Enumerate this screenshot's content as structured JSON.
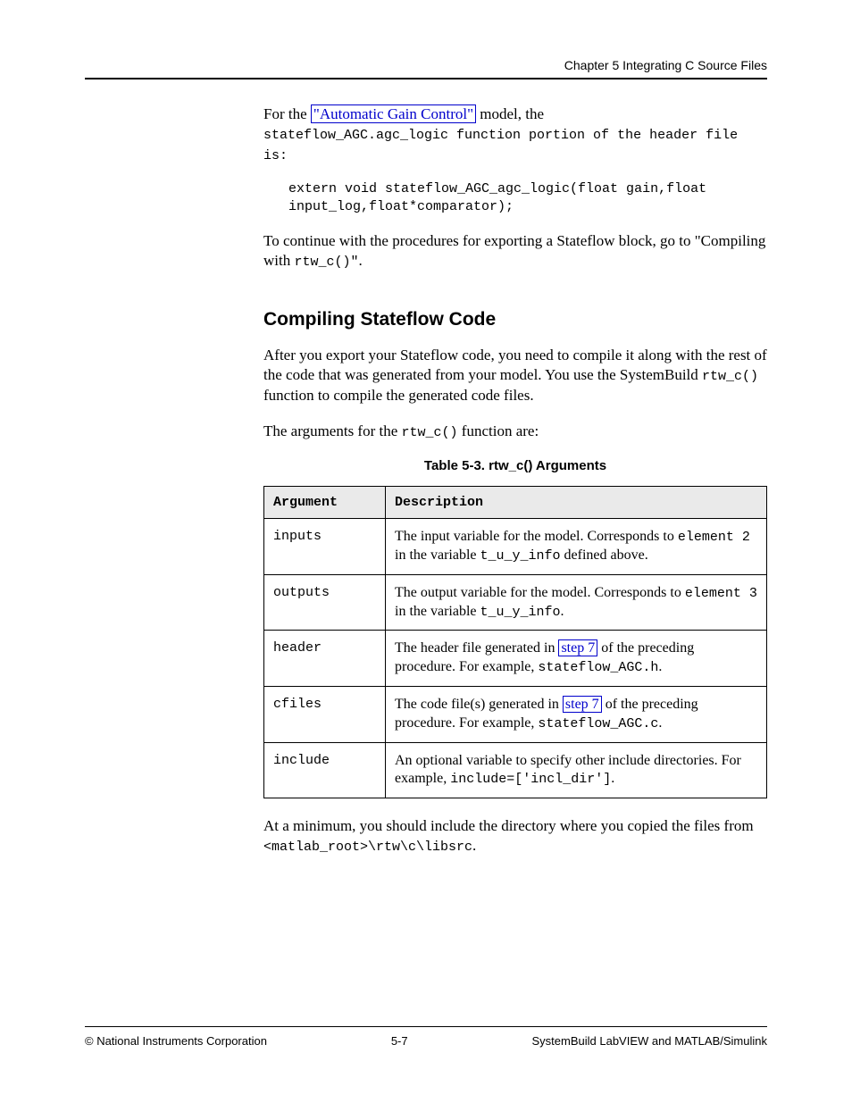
{
  "header": {
    "title": "Chapter 5 Integrating C Source Files"
  },
  "content": {
    "p1_prefix": "For the ",
    "p1_link": "\"Automatic Gain Control\"",
    "p1_suffix": " model, the",
    "p2": "stateflow_AGC.agc_logic function portion of the header file is:",
    "code1_1": "extern void stateflow_AGC_agc_logic(float gain,float",
    "code1_2": "input_log,float*comparator);",
    "p3_prefix": "To continue with the procedures for exporting a Stateflow block, go to",
    "p3_link_pre": "\"Compiling with",
    "p3_link_after": "rtw_c()\"",
    "p3_suffix": ".",
    "section": "Compiling Stateflow Code",
    "p4_prefix": "After you export your Stateflow code, you need to compile it along with the rest of the code that was generated from your model. You use the SystemBuild ",
    "p4_code": "rtw_c()",
    "p4_suffix": " function to compile the generated code files.",
    "p5_prefix": "The arguments for the ",
    "p5_code": "rtw_c()",
    "p5_suffix": " function are:",
    "table_caption": "Table 5-3.  rtw_c() Arguments"
  },
  "table": {
    "headers": {
      "col1": "Argument",
      "col2": "Description"
    },
    "rows": [
      {
        "arg": "inputs",
        "desc_prefix": "The input variable for the model. Corresponds to ",
        "desc_code": "element 2",
        "desc_middle": " in the variable ",
        "desc_code2": "t_u_y_info",
        "desc_suffix": " defined above."
      },
      {
        "arg": "outputs",
        "desc_prefix": "The output variable for the model. Corresponds to ",
        "desc_code": "element 3",
        "desc_middle": " in the variable ",
        "desc_code2": "t_u_y_info",
        "desc_suffix": "."
      },
      {
        "arg": "header",
        "desc_prefix": "The header file generated in ",
        "desc_link": "step 7",
        "desc_suffix": " of the preceding procedure. For example, ",
        "desc_code": "stateflow_AGC.h",
        "desc_suffix2": "."
      },
      {
        "arg": "cfiles",
        "desc_prefix": "The code file(s) generated in ",
        "desc_link": "step 7",
        "desc_suffix": " of the preceding procedure. For example, ",
        "desc_code": "stateflow_AGC.c",
        "desc_suffix2": "."
      },
      {
        "arg": "include",
        "desc_prefix": "An optional variable to specify other include directories. For example, ",
        "desc_code": "include=['incl_dir']",
        "desc_suffix2": "."
      }
    ]
  },
  "p6_prefix": "At a minimum, you should include the directory where you copied the files from ",
  "p6_code": "<matlab_root>\\rtw\\c\\libsrc",
  "p6_suffix": ".",
  "footer": {
    "left": "© National Instruments Corporation",
    "center": "5-7",
    "right": "SystemBuild LabVIEW and MATLAB/Simulink"
  }
}
